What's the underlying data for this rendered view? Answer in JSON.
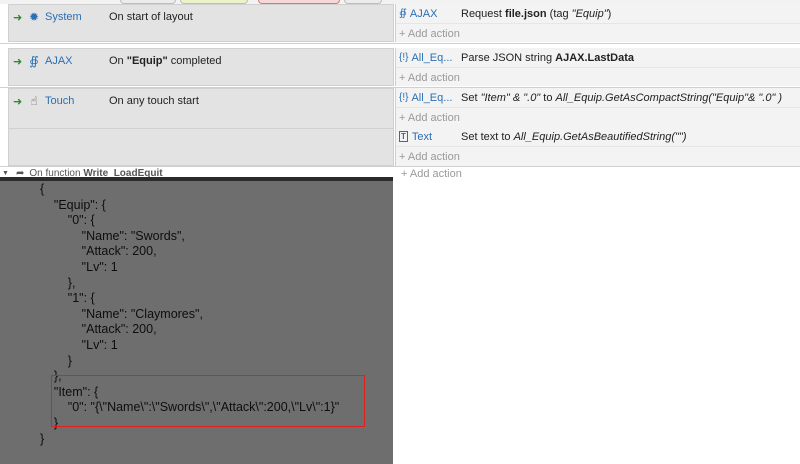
{
  "events": [
    {
      "condition": {
        "object": "System",
        "object_icon": "gear-icon",
        "text_plain": "On start of layout"
      },
      "actions": [
        {
          "object": "AJAX",
          "object_icon": "ajax-icon",
          "prefix": "Request ",
          "bold": "file.json",
          "mid": " (tag ",
          "italic": "\"Equip\"",
          "suffix": ")"
        }
      ],
      "add_action": "+ Add action"
    },
    {
      "condition": {
        "object": "AJAX",
        "object_icon": "ajax-icon",
        "prefix": "On ",
        "bold": "\"Equip\"",
        "suffix": " completed"
      },
      "actions": [
        {
          "object": "All_Eq...",
          "object_icon": "json-icon",
          "prefix": "Parse JSON string ",
          "bold": "AJAX.LastData",
          "mid": "",
          "italic": "",
          "suffix": ""
        }
      ],
      "add_action": "+ Add action"
    },
    {
      "condition": {
        "object": "Touch",
        "object_icon": "touch-icon",
        "text_plain": "On any touch start"
      },
      "actions": [
        {
          "object": "All_Eq...",
          "object_icon": "json-icon",
          "prefix": "Set ",
          "italic1": "\"Item\" & \".0\"",
          "mid": "  to ",
          "italic": "All_Equip.GetAsCompactString(\"Equip\"& \".0\" )",
          "suffix": ""
        },
        {
          "object": "Text",
          "object_icon": "text-icon",
          "prefix": "Set text to ",
          "italic": "All_Equip.GetAsBeautifiedString(\"\")",
          "suffix": ""
        }
      ],
      "add_action": "+ Add action"
    }
  ],
  "function_row": {
    "prefix": "On function ",
    "bold": "Write_LoadEquit"
  },
  "trailing_add_action": "+ Add action",
  "json_output": "{\n    \"Equip\": {\n        \"0\": {\n            \"Name\": \"Swords\",\n            \"Attack\": 200,\n            \"Lv\": 1\n        },\n        \"1\": {\n            \"Name\": \"Claymores\",\n            \"Attack\": 200,\n            \"Lv\": 1\n        }\n    },\n    \"Item\": {\n        \"0\": \"{\\\"Name\\\":\\\"Swords\\\",\\\"Attack\\\":200,\\\"Lv\\\":1}\"\n    }\n}",
  "colors": {
    "object_link": "#2a6fb3",
    "condition_bg": "#e3e3e3",
    "highlight": "#e0201f",
    "panel_bg": "#6e6e6e"
  }
}
